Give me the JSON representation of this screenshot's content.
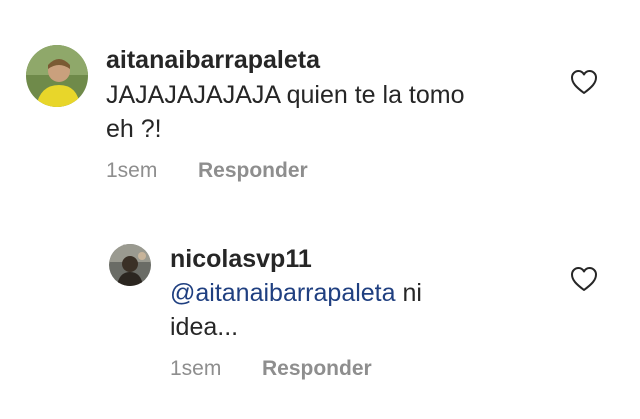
{
  "comments": [
    {
      "username": "aitanaibarrapaleta",
      "text_line1": "JAJAJAJAJAJA quien te la tomo",
      "text_line2": "eh ?!",
      "time": "1sem",
      "reply_label": "Responder",
      "avatar_icon": "user-avatar-yellow-shirt"
    }
  ],
  "reply": {
    "username": "nicolasvp11",
    "mention": "@aitanaibarrapaleta",
    "text_after_mention": " ni",
    "text_line2": "idea...",
    "time": "1sem",
    "reply_label": "Responder",
    "avatar_icon": "user-avatar-dark"
  },
  "icons": {
    "like": "heart-outline-icon"
  },
  "colors": {
    "text": "#262626",
    "muted": "#8e8e8e",
    "mention": "#1f3f80"
  }
}
